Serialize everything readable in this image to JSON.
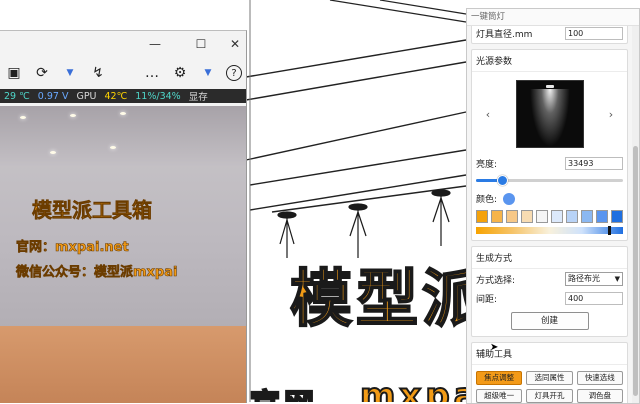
{
  "left_window": {
    "toolbar": {
      "more_label": "…"
    },
    "status": {
      "temp_cpu": "29 ℃",
      "voltage": "0.97 V",
      "gpu_label": "GPU",
      "gpu_temp": "42℃",
      "gpu_usage": "11%/34%",
      "memory_label": "显存"
    },
    "photo": {
      "wall_title": "模型派工具箱",
      "wall_line1": "官网：mxpai.net",
      "wall_line2": "微信公众号：模型派mxpai"
    }
  },
  "viewport": {
    "wall_text_1": "模型派",
    "wall_text_2_left": "官网",
    "wall_text_2_right": "mxpai.net"
  },
  "panel": {
    "title": "一键筒灯",
    "diameter": {
      "label": "灯具直径.mm",
      "value": "100"
    },
    "light_source": {
      "title": "光源参数",
      "brightness_label": "亮度:",
      "brightness_value": "33493",
      "brightness_level": 0.18,
      "color_label": "颜色:",
      "current_color": "#5a95ef",
      "swatches": [
        "#f4a20c",
        "#f6b44a",
        "#f7c887",
        "#f8dcb2",
        "#f5f5f5",
        "#dce9fb",
        "#b8d3f7",
        "#8bb8f2",
        "#5a95ef",
        "#1f6fe0"
      ],
      "gradient_marker": 0.9
    },
    "generate": {
      "title": "生成方式",
      "method_label": "方式选择:",
      "method_value": "路径布光",
      "spacing_label": "间距:",
      "spacing_value": "400",
      "create_label": "创建"
    },
    "tools": {
      "title": "辅助工具",
      "buttons": [
        "焦点调整",
        "选同属性",
        "快速选线",
        "超级唯一",
        "灯具开孔",
        "调色盘"
      ]
    }
  }
}
